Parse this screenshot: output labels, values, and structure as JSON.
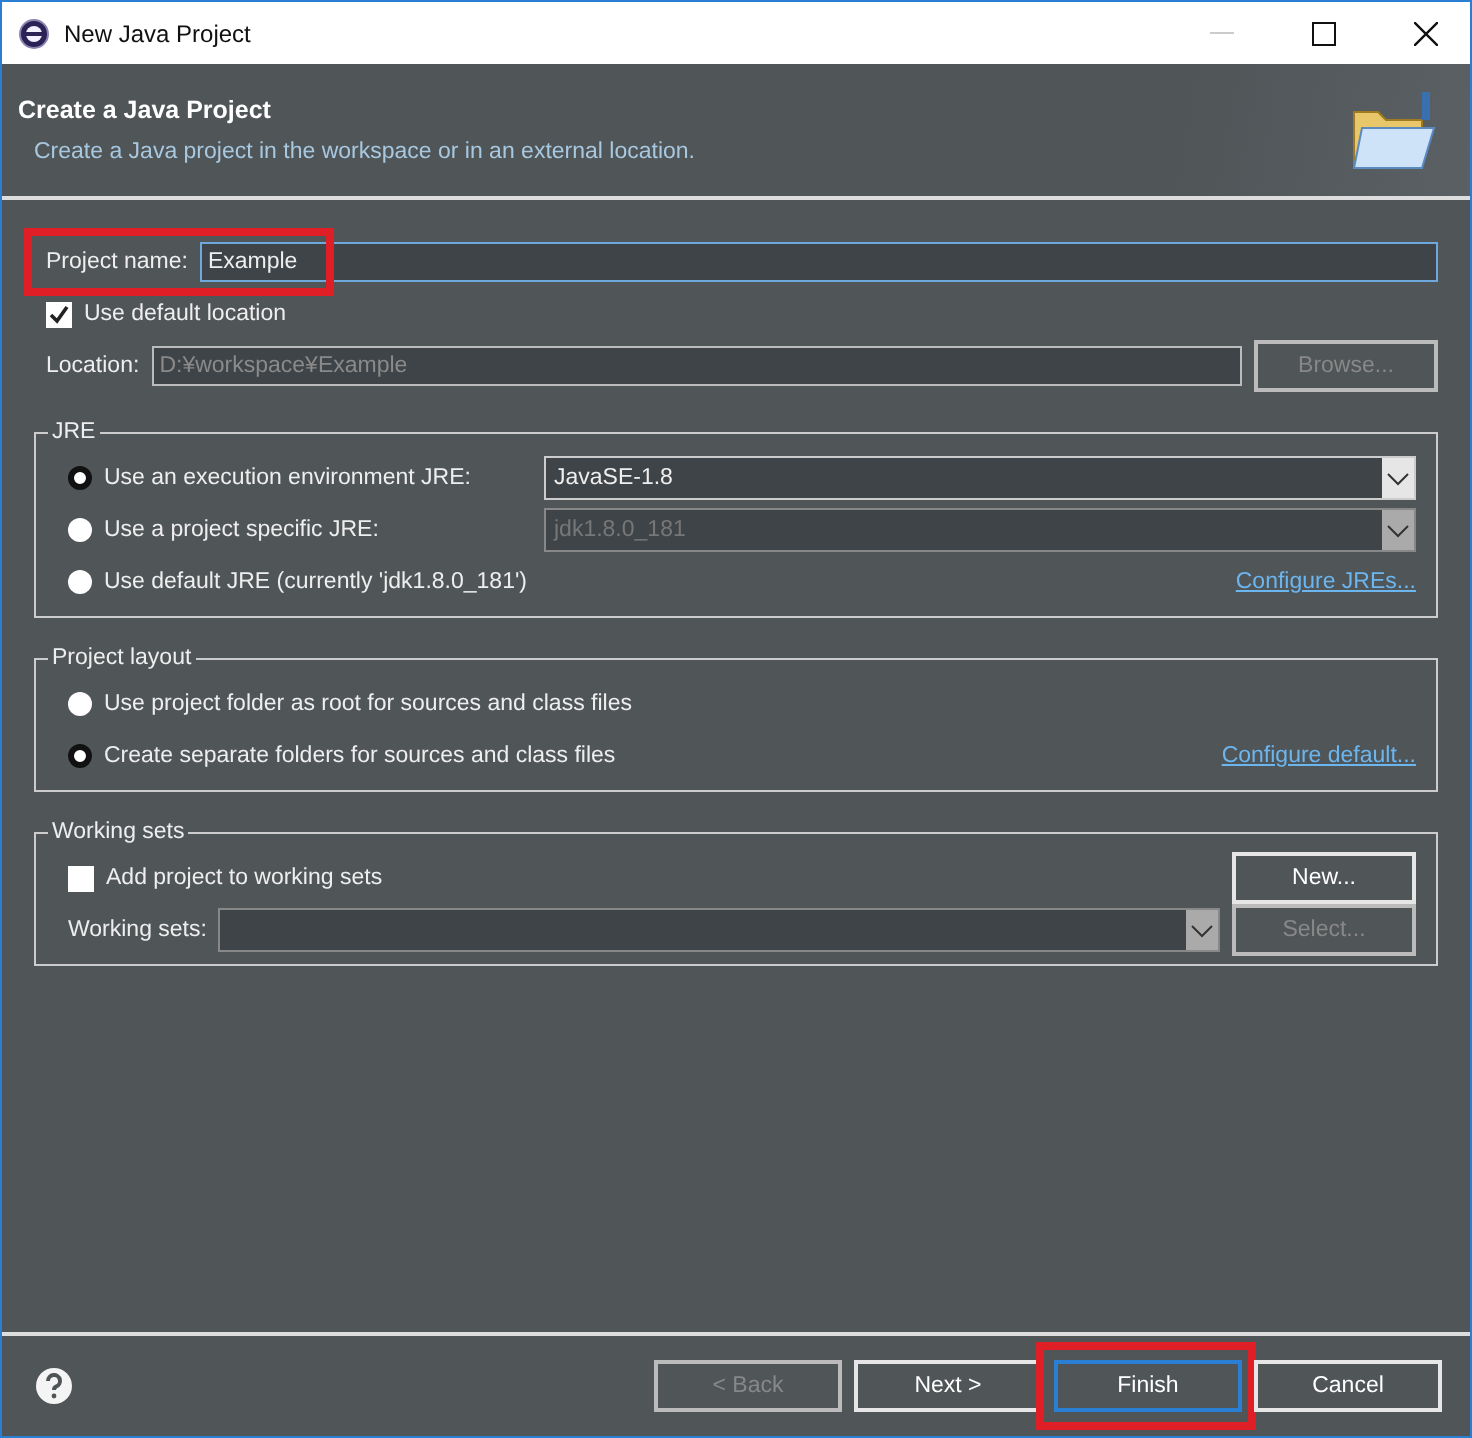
{
  "window": {
    "title": "New Java Project"
  },
  "header": {
    "title": "Create a Java Project",
    "description": "Create a Java project in the workspace or in an external location."
  },
  "project_name": {
    "label": "Project name:",
    "value": "Example",
    "highlighted": true
  },
  "use_default_location": {
    "label": "Use default location",
    "checked": true
  },
  "location": {
    "label": "Location:",
    "value": "D:¥workspace¥Example",
    "disabled": true,
    "button": "Browse...",
    "button_disabled": true
  },
  "jre": {
    "title": "JRE",
    "options": [
      {
        "label": "Use an execution environment JRE:",
        "selected": true,
        "dropdown": {
          "value": "JavaSE-1.8",
          "disabled": false
        }
      },
      {
        "label": "Use a project specific JRE:",
        "selected": false,
        "dropdown": {
          "value": "jdk1.8.0_181",
          "disabled": true
        }
      },
      {
        "label": "Use default JRE (currently 'jdk1.8.0_181')",
        "selected": false,
        "link": "Configure JREs..."
      }
    ]
  },
  "project_layout": {
    "title": "Project layout",
    "options": [
      {
        "label": "Use project folder as root for sources and class files",
        "selected": false
      },
      {
        "label": "Create separate folders for sources and class files",
        "selected": true,
        "link": "Configure default..."
      }
    ]
  },
  "working_sets": {
    "title": "Working sets",
    "add": {
      "label": "Add project to working sets",
      "checked": false
    },
    "new_button": "New...",
    "label": "Working sets:",
    "select_button": "Select...",
    "disabled": true
  },
  "buttons": [
    {
      "label": "< Back",
      "disabled": true,
      "highlighted": false
    },
    {
      "label": "Next >",
      "disabled": false,
      "highlighted": false
    },
    {
      "label": "Finish",
      "disabled": false,
      "highlighted": true
    },
    {
      "label": "Cancel",
      "disabled": false,
      "highlighted": false
    }
  ]
}
